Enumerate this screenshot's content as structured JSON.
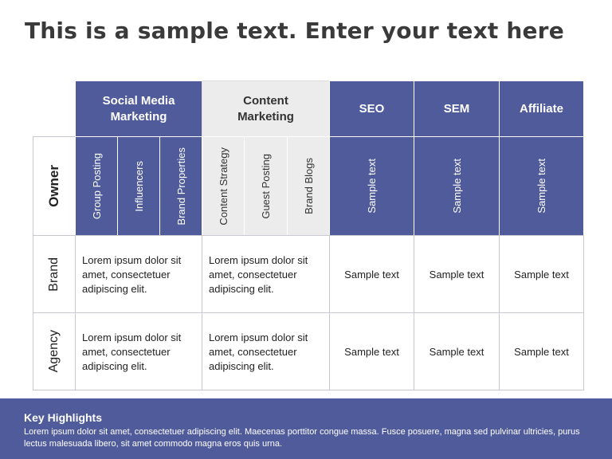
{
  "title": "This is a sample text. Enter your text here",
  "headers": [
    "Social Media Marketing",
    "Content Marketing",
    "SEO",
    "SEM",
    "Affiliate"
  ],
  "subheaders": {
    "smm": [
      "Group Posting",
      "Influencers",
      "Brand Properties"
    ],
    "cm": [
      "Content Strategy",
      "Guest Posting",
      "Brand Blogs"
    ],
    "other": [
      "Sample text",
      "Sample text",
      "Sample text"
    ]
  },
  "rows": [
    {
      "label": "Owner"
    },
    {
      "label": "Brand",
      "smm": "Lorem ipsum dolor sit amet, consectetuer adipiscing elit.",
      "cm": "Lorem ipsum dolor sit amet, consectetuer adipiscing elit.",
      "seo": "Sample text",
      "sem": "Sample text",
      "aff": "Sample text"
    },
    {
      "label": "Agency",
      "smm": "Lorem ipsum dolor sit amet, consectetuer adipiscing elit.",
      "cm": "Lorem ipsum dolor sit amet, consectetuer adipiscing elit.",
      "seo": "Sample text",
      "sem": "Sample text",
      "aff": "Sample text"
    }
  ],
  "footer": {
    "heading": "Key Highlights",
    "text": "Lorem ipsum dolor sit amet, consectetuer adipiscing elit. Maecenas porttitor congue massa. Fusce posuere, magna sed pulvinar ultricies, purus lectus malesuada libero, sit amet commodo magna eros quis urna."
  },
  "colors": {
    "accent": "#4f5b9b",
    "grey": "#ececec"
  }
}
